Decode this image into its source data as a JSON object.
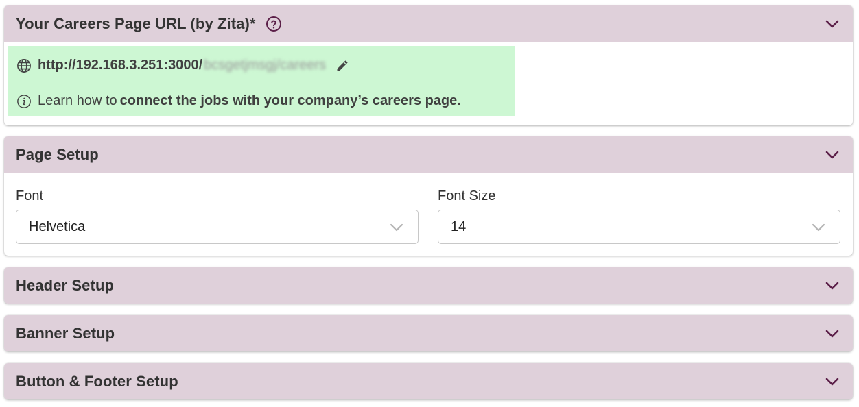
{
  "careers_url": {
    "title": "Your Careers Page URL (by Zita)*",
    "url_visible": "http://192.168.3.251:3000/",
    "url_blurred": "bcsgetjmsgj/careers",
    "learn_prefix": "Learn how to",
    "learn_link": "connect the jobs with your company’s careers page."
  },
  "page_setup": {
    "title": "Page Setup",
    "font_label": "Font",
    "font_value": "Helvetica",
    "font_size_label": "Font Size",
    "font_size_value": "14"
  },
  "header_setup": {
    "title": "Header Setup"
  },
  "banner_setup": {
    "title": "Banner Setup"
  },
  "button_footer_setup": {
    "title": "Button & Footer Setup"
  },
  "colors": {
    "header_bg": "#dfd0da",
    "chevron": "#5b1f48",
    "highlight_bg": "#cdf7d3"
  },
  "icons": [
    "help-circle-icon",
    "chevron-down-icon",
    "globe-icon",
    "pencil-icon",
    "info-icon",
    "dropdown-chevron-icon"
  ]
}
